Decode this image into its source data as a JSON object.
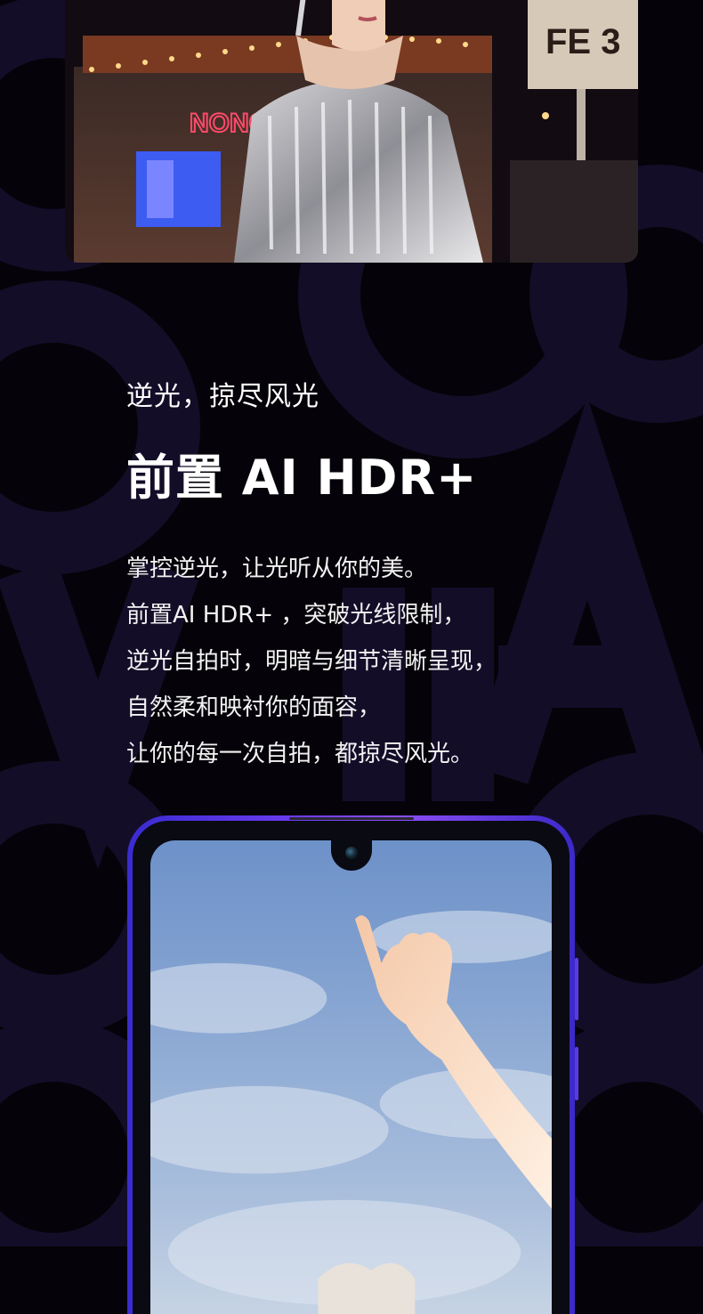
{
  "section": {
    "kicker": "逆光，掠尽风光",
    "headline": "前置 AI HDR+",
    "body_lines": [
      "掌控逆光，让光听从你的美。",
      "前置AI HDR+ ，突破光线限制，",
      "逆光自拍时，明暗与细节清晰呈现，",
      "自然柔和映衬你的面容，",
      "让你的每一次自拍，都掠尽风光。"
    ]
  },
  "photo": {
    "neon_sign": "NONO",
    "sign_fragment": "FE 3"
  },
  "colors": {
    "background": "#050309",
    "bg_letter": "#140d28",
    "phone_frame": "#6f3cf0",
    "text": "#ffffff"
  }
}
